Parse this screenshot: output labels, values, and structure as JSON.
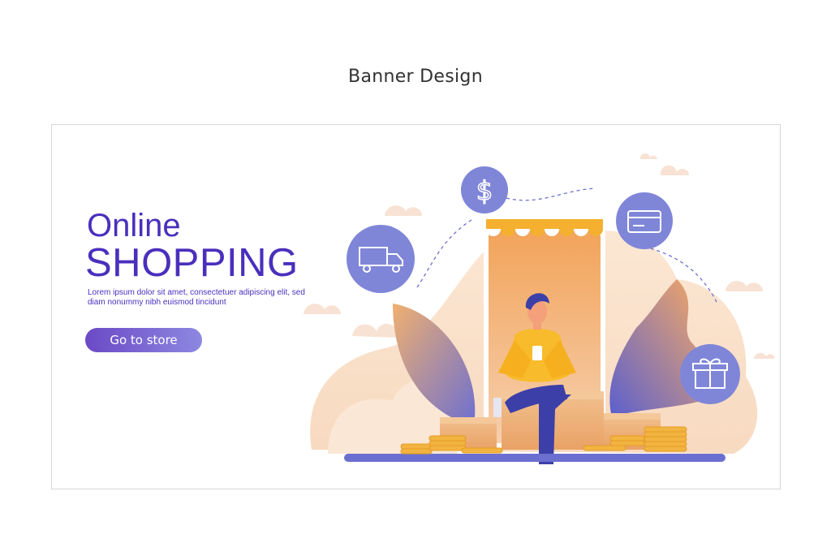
{
  "page": {
    "heading": "Banner Design"
  },
  "banner": {
    "headline_line1": "Online",
    "headline_line2": "SHOPPING",
    "body_text": "Lorem ipsum dolor sit amet, consectetuer adipiscing elit, sed diam nonummy nibh euismod tincidunt",
    "cta_label": "Go to store"
  },
  "illustration": {
    "icons": [
      "truck-icon",
      "dollar-icon",
      "credit-card-icon",
      "gift-icon"
    ],
    "colors": {
      "purple": "#4a2fbd",
      "circle": "#7f86d8",
      "orange": "#f0a85a",
      "peach": "#f8dcc2",
      "coin": "#f2b440",
      "shirt": "#f7bb2c"
    }
  }
}
